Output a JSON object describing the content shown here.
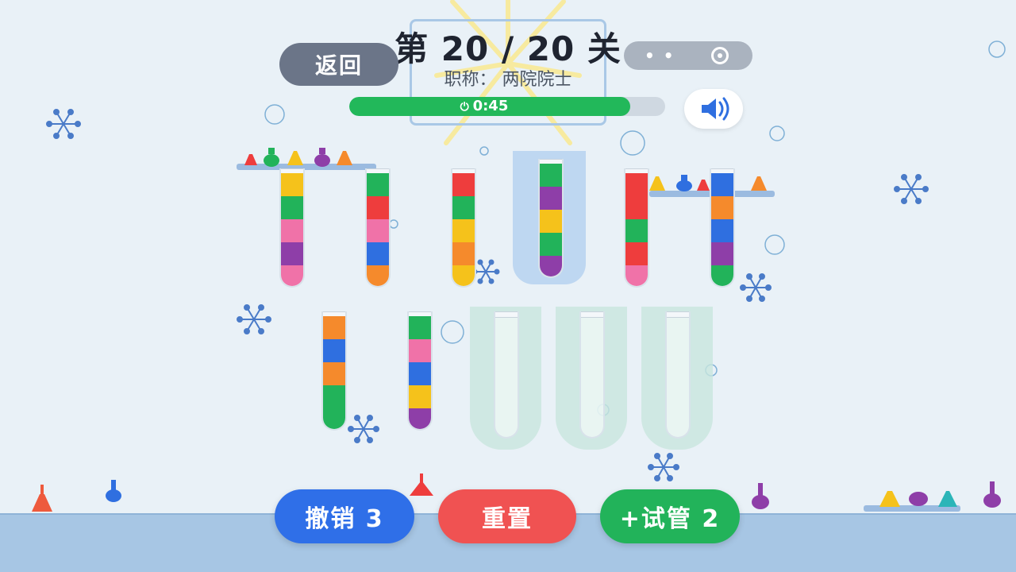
{
  "header": {
    "level_title": "第 20 / 20 关",
    "rank_line": "职称：  两院院士",
    "back_label": "返回",
    "timer_text": "0:45",
    "timer_progress": 0.89,
    "menu_dots": "• •"
  },
  "tubes": [
    {
      "id": "t1",
      "colors": [
        "yellow",
        "green",
        "pink",
        "purple",
        "pink"
      ]
    },
    {
      "id": "t2",
      "colors": [
        "green",
        "red",
        "pink",
        "blue",
        "orange"
      ]
    },
    {
      "id": "t3",
      "colors": [
        "red",
        "green",
        "yellow",
        "orange",
        "yellow"
      ]
    },
    {
      "id": "t4",
      "colors": [
        "green",
        "purple",
        "yellow",
        "green",
        "purple"
      ],
      "selected": true
    },
    {
      "id": "t5",
      "colors": [
        "red",
        "red",
        "green",
        "red",
        "pink"
      ]
    },
    {
      "id": "t6",
      "colors": [
        "blue",
        "orange",
        "blue",
        "purple",
        "green"
      ]
    },
    {
      "id": "t7",
      "colors": [
        "orange",
        "blue",
        "orange",
        "green",
        "green"
      ]
    },
    {
      "id": "t8",
      "colors": [
        "green",
        "pink",
        "blue",
        "yellow",
        "purple"
      ]
    },
    {
      "id": "t9",
      "colors": []
    },
    {
      "id": "t10",
      "colors": []
    },
    {
      "id": "t11",
      "colors": []
    }
  ],
  "palette": {
    "yellow": "#f5c21b",
    "green": "#22b35a",
    "pink": "#f072a8",
    "purple": "#8e3ea8",
    "red": "#ee3d3d",
    "blue": "#2f6fe0",
    "orange": "#f58a2c"
  },
  "buttons": {
    "undo_label": "撤销 3",
    "reset_label": "重置",
    "add_tube_label": "+试管 2"
  },
  "colors": {
    "undo": "#2f6fe8",
    "reset": "#f05252",
    "add_tube": "#22b35a"
  }
}
